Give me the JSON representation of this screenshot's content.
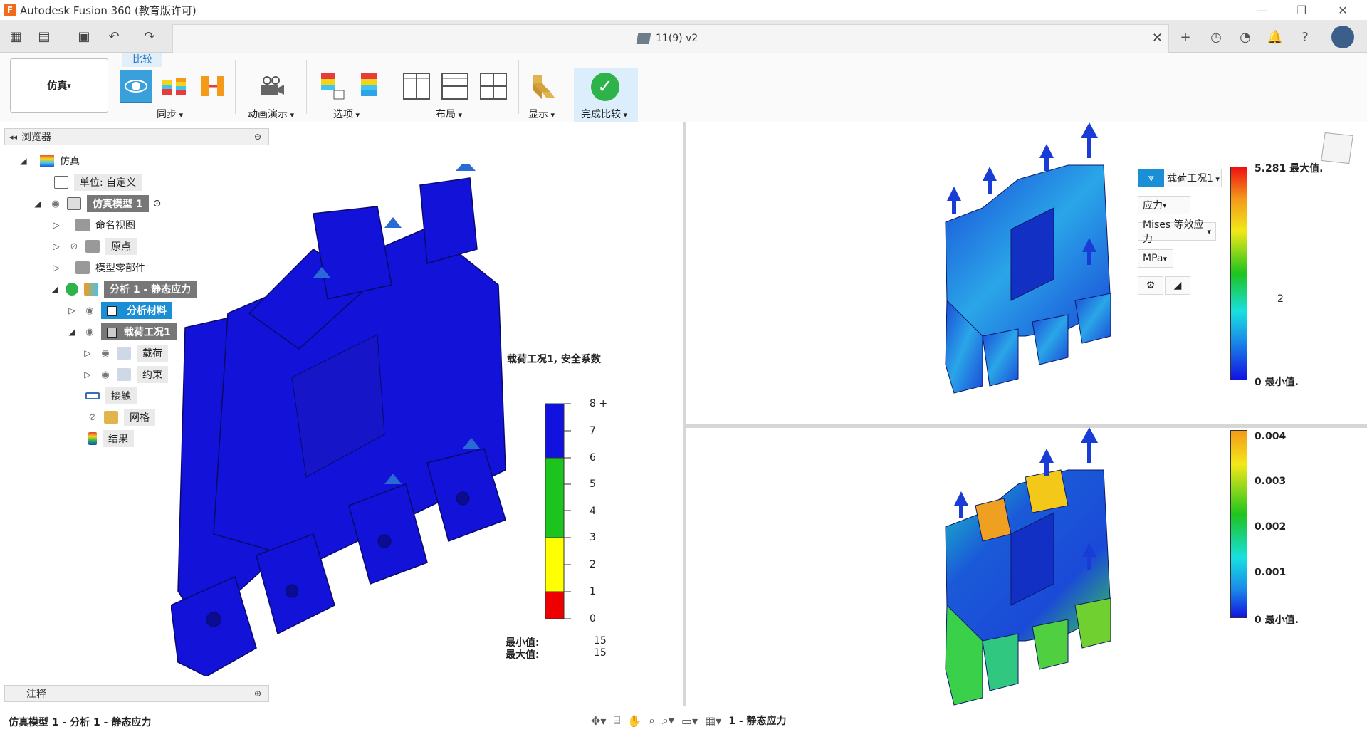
{
  "app": {
    "title": "Autodesk Fusion 360 (教育版许可)",
    "logo_letter": "F",
    "window_controls": {
      "minimize": "—",
      "maximize": "❐",
      "close": "✕"
    }
  },
  "document_tab": {
    "name": "11(9) v2",
    "close": "✕"
  },
  "quick_access": {
    "grid_icon": "▦",
    "file_icon": "▤",
    "save_icon": "▣",
    "undo_icon": "↶",
    "redo_icon": "↷"
  },
  "right_icons": [
    "+",
    "◷",
    "◔",
    "🔔",
    "?"
  ],
  "toolbar": {
    "workspace": "仿真",
    "compare_tab": "比较",
    "groups": {
      "sync": "同步",
      "animation": "动画演示",
      "options": "选项",
      "layout": "布局",
      "display": "显示",
      "finish": "完成比较"
    }
  },
  "browser": {
    "header": "浏览器",
    "items": [
      {
        "label": "仿真"
      },
      {
        "label": "单位: 自定义"
      },
      {
        "label": "仿真模型 1"
      },
      {
        "label": "命名视图"
      },
      {
        "label": "原点"
      },
      {
        "label": "模型零部件"
      },
      {
        "label": "分析 1 - 静态应力"
      },
      {
        "label": "分析材料"
      },
      {
        "label": "载荷工况1"
      },
      {
        "label": "载荷"
      },
      {
        "label": "约束"
      },
      {
        "label": "接触"
      },
      {
        "label": "网格"
      },
      {
        "label": "结果"
      }
    ]
  },
  "notes_panel": {
    "label": "注释"
  },
  "left_viewport": {
    "legend_title": "载荷工况1, 安全系数",
    "ticks": [
      "8 +",
      "7",
      "6",
      "5",
      "4",
      "3",
      "2",
      "1",
      "0"
    ],
    "min_label": "最小值:",
    "max_label": "最大值:",
    "min_value": "15",
    "max_value": "15"
  },
  "right_top_viewport": {
    "load_case": "载荷工况1",
    "result_type": "应力",
    "component": "Mises 等效应力",
    "unit": "MPa",
    "ticks": [
      "5.281 最大值.",
      "2",
      "0 最小值."
    ]
  },
  "right_bottom_viewport": {
    "ticks": [
      "0.004",
      "0.003",
      "0.002",
      "0.001",
      "0 最小值."
    ]
  },
  "status": {
    "left": "仿真模型 1 - 分析 1 - 静态应力",
    "center": "1 - 静态应力"
  },
  "colors": {
    "model_blue": "#1212d8",
    "accent": "#3aa0dc",
    "finish_green": "#2db34a"
  }
}
